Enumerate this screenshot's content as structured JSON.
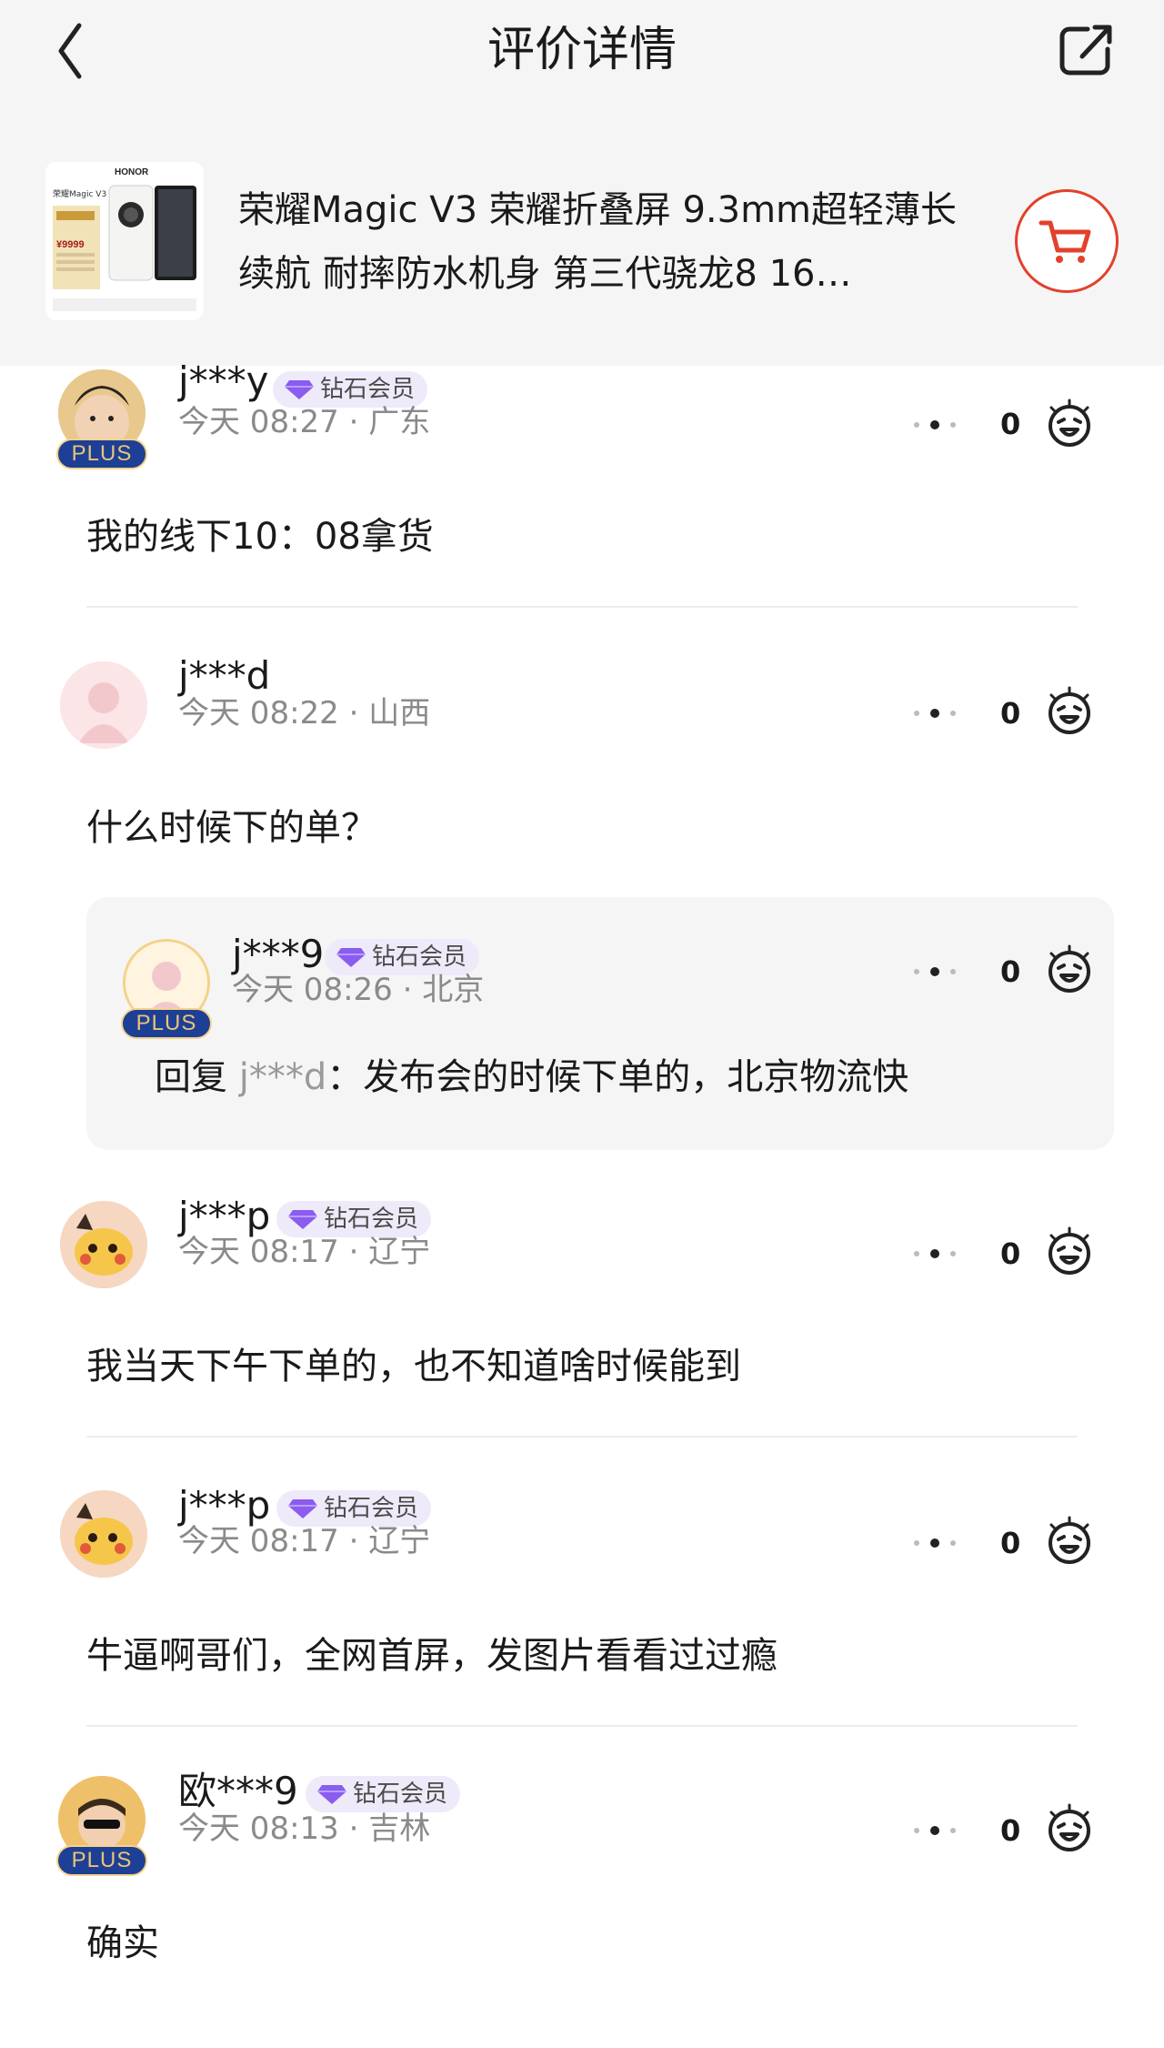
{
  "header": {
    "title": "评价详情"
  },
  "product": {
    "title": "荣耀Magic V3 荣耀折叠屏 9.3mm超轻薄长续航 耐摔防水机身 第三代骁龙8 16…",
    "thumb": {
      "brand": "HONOR",
      "model": "荣耀Magic V3",
      "price": "¥9999"
    }
  },
  "vip_label": "钻石会员",
  "plus_label": "PLUS",
  "comments": [
    {
      "user": "j***y",
      "time": "今天 08:27 · 广东",
      "likes": "0",
      "text": "我的线下10：08拿货"
    },
    {
      "user": "j***d",
      "time": "今天 08:22 · 山西",
      "likes": "0",
      "text": "什么时候下的单？",
      "reply": {
        "user": "j***9",
        "time": "今天 08:26 · 北京",
        "likes": "0",
        "prefix": "回复 ",
        "to": "j***d",
        "text": "：发布会的时候下单的，北京物流快"
      }
    },
    {
      "user": "j***p",
      "time": "今天 08:17 · 辽宁",
      "likes": "0",
      "text": "我当天下午下单的，也不知道啥时候能到"
    },
    {
      "user": "j***p",
      "time": "今天 08:17 · 辽宁",
      "likes": "0",
      "text": "牛逼啊哥们，全网首屏，发图片看看过过瘾"
    },
    {
      "user": "欧***9",
      "time": "今天 08:13 · 吉林",
      "likes": "0",
      "text": "确实"
    }
  ],
  "colors": {
    "accent": "#e2412b",
    "vip_bg": "#efeaf9",
    "plus_bg": "#1d3f95"
  }
}
